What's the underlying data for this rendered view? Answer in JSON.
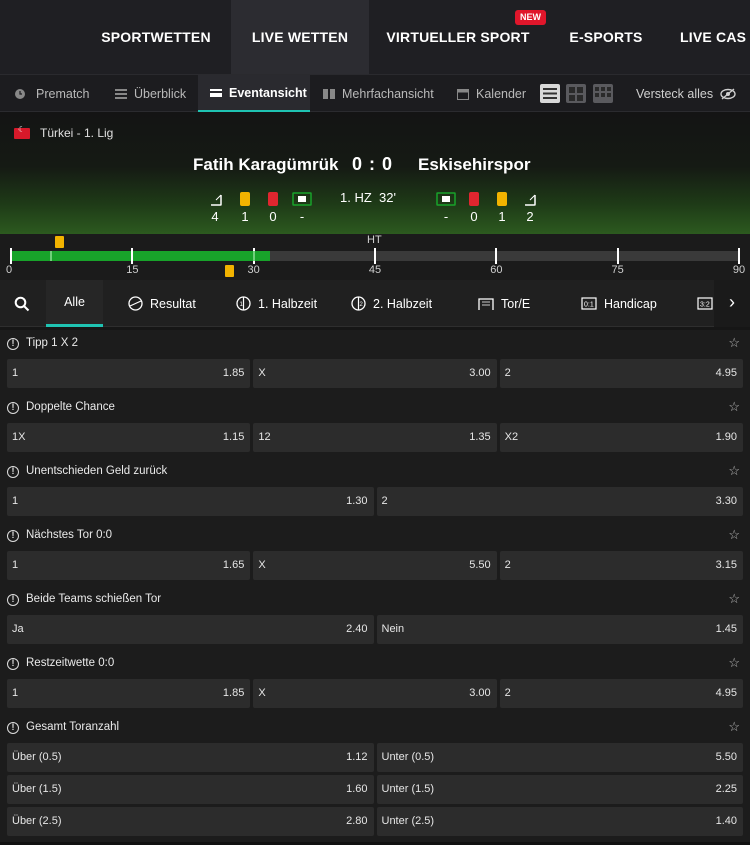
{
  "topnav": {
    "items": [
      "SPORTWETTEN",
      "LIVE WETTEN",
      "VIRTUELLER SPORT",
      "E-SPORTS",
      "LIVE CAS"
    ],
    "badge": "NEW"
  },
  "subnav": {
    "tabs": [
      "Prematch",
      "Überblick",
      "Eventansicht",
      "Mehrfachansicht",
      "Kalender"
    ],
    "hide_all": "Versteck alles"
  },
  "match": {
    "league": "Türkei - 1. Lig",
    "home": "Fatih Karagümrük",
    "away": "Eskisehirspor",
    "score": "0 : 0",
    "period": "1. HZ",
    "minute": "32'",
    "home_stats": [
      "4",
      "1",
      "0",
      "-"
    ],
    "away_stats": [
      "-",
      "0",
      "1",
      "2"
    ]
  },
  "timeline": {
    "ht_label": "HT",
    "labels": [
      "0",
      "15",
      "30",
      "45",
      "60",
      "75",
      "90"
    ],
    "elapsed_minutes": 32
  },
  "market_tabs": [
    "Alle",
    "Resultat",
    "1. Halbzeit",
    "2. Halbzeit",
    "Tor/E",
    "Handicap"
  ],
  "markets": [
    {
      "title": "Tipp 1 X 2",
      "rows": [
        [
          [
            "1",
            "1.85"
          ],
          [
            "X",
            "3.00"
          ],
          [
            "2",
            "4.95"
          ]
        ]
      ]
    },
    {
      "title": "Doppelte Chance",
      "rows": [
        [
          [
            "1X",
            "1.15"
          ],
          [
            "12",
            "1.35"
          ],
          [
            "X2",
            "1.90"
          ]
        ]
      ]
    },
    {
      "title": "Unentschieden Geld zurück",
      "rows": [
        [
          [
            "1",
            "1.30"
          ],
          [
            "2",
            "3.30"
          ]
        ]
      ]
    },
    {
      "title": "Nächstes Tor 0:0",
      "rows": [
        [
          [
            "1",
            "1.65"
          ],
          [
            "X",
            "5.50"
          ],
          [
            "2",
            "3.15"
          ]
        ]
      ]
    },
    {
      "title": "Beide Teams schießen Tor",
      "rows": [
        [
          [
            "Ja",
            "2.40"
          ],
          [
            "Nein",
            "1.45"
          ]
        ]
      ]
    },
    {
      "title": "Restzeitwette 0:0",
      "rows": [
        [
          [
            "1",
            "1.85"
          ],
          [
            "X",
            "3.00"
          ],
          [
            "2",
            "4.95"
          ]
        ]
      ]
    },
    {
      "title": "Gesamt Toranzahl",
      "rows": [
        [
          [
            "Über (0.5)",
            "1.12"
          ],
          [
            "Unter (0.5)",
            "5.50"
          ]
        ],
        [
          [
            "Über (1.5)",
            "1.60"
          ],
          [
            "Unter (1.5)",
            "2.25"
          ]
        ],
        [
          [
            "Über (2.5)",
            "2.80"
          ],
          [
            "Unter (2.5)",
            "1.40"
          ]
        ]
      ]
    }
  ]
}
